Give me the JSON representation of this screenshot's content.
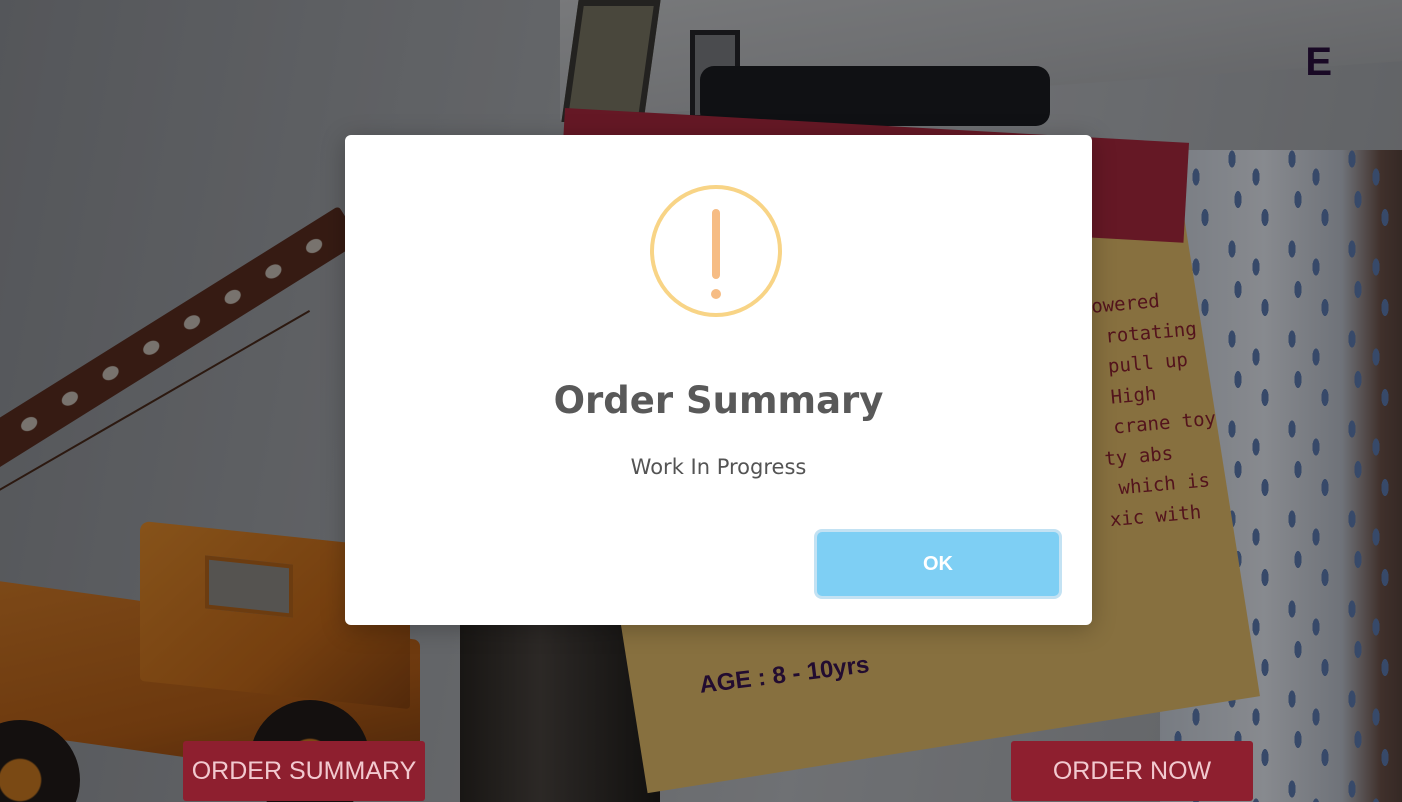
{
  "background_scene": {
    "card_header_text": "E",
    "card_description": "owered\n rotating\n pull up\n High\n crane toy\nty abs\n which is\nxic with",
    "card_age": "AGE : 8 - 10yrs"
  },
  "app_buttons": {
    "order_summary": "ORDER SUMMARY",
    "order_now": "ORDER NOW"
  },
  "dialog": {
    "icon": "warning-icon",
    "title": "Order Summary",
    "message": "Work In Progress",
    "ok_label": "OK"
  },
  "colors": {
    "app_button": "#8e1f2f",
    "ok_button": "#7ecff4",
    "warning_ring": "#f8d486",
    "warning_mark": "#f6bc84"
  }
}
